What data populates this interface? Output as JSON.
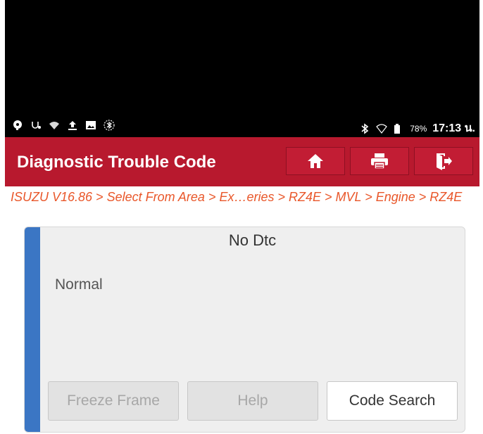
{
  "status_bar": {
    "battery": "78%",
    "time": "17:13 น."
  },
  "title_bar": {
    "title": "Diagnostic Trouble Code",
    "buttons": [
      "home-icon",
      "print-icon",
      "exit-icon"
    ]
  },
  "breadcrumb": "ISUZU V16.86 > Select From Area > Ex…eries > RZ4E > MVL > Engine > RZ4E",
  "panel": {
    "title": "No Dtc",
    "status": "Normal",
    "buttons": {
      "freeze_frame": "Freeze Frame",
      "help": "Help",
      "code_search": "Code Search"
    }
  },
  "colors": {
    "title_bar": "#b8192e",
    "accent": "#3b76c4",
    "breadcrumb": "#e9572a"
  }
}
